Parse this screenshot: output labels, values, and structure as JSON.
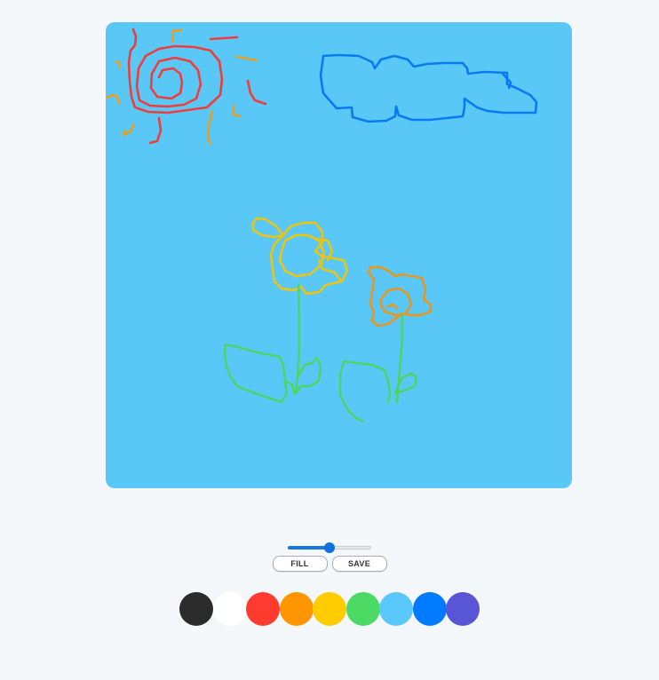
{
  "canvas": {
    "background": "#5ac8f7",
    "strokes": {
      "sun": "#ee3d3a",
      "sun_rays": "#f39c12",
      "cloud": "#0a7af0",
      "yellow_flower": "#f5c400",
      "orange_flower": "#f39314",
      "stems": "#4cd563"
    }
  },
  "brush_size": {
    "value": 0.5
  },
  "buttons": {
    "fill_label": "FILL",
    "save_label": "SAVE"
  },
  "palette": [
    {
      "name": "black",
      "color": "#2b2b2b"
    },
    {
      "name": "white",
      "color": "#ffffff"
    },
    {
      "name": "red",
      "color": "#ff3b30"
    },
    {
      "name": "orange",
      "color": "#ff9500"
    },
    {
      "name": "yellow",
      "color": "#ffcc00"
    },
    {
      "name": "green",
      "color": "#4cd964"
    },
    {
      "name": "light-blue",
      "color": "#5ac8fa"
    },
    {
      "name": "blue",
      "color": "#007aff"
    },
    {
      "name": "purple",
      "color": "#5856d6"
    }
  ]
}
